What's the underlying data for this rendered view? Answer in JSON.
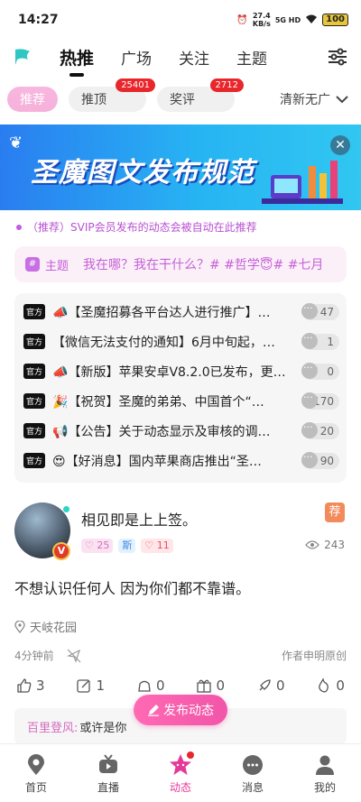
{
  "status_bar": {
    "time": "14:27",
    "net_speed_value": "27.4",
    "net_speed_unit": "KB/s",
    "signal": "5G HD",
    "battery": "100"
  },
  "top_nav": {
    "tabs": [
      "热推",
      "广场",
      "关注",
      "主题"
    ],
    "active_tab": "热推"
  },
  "sub_tabs": {
    "items": [
      {
        "label": "推荐",
        "badge": ""
      },
      {
        "label": "推顶",
        "badge": "25401"
      },
      {
        "label": "奖评",
        "badge": "2712"
      }
    ],
    "mode": "清新无广"
  },
  "banner": {
    "title": "圣魔图文发布规范",
    "close": "✕"
  },
  "promo": {
    "text": "（推荐）SVIP会员发布的动态会被自动在此推荐"
  },
  "topic": {
    "label": "主题",
    "text": "我在哪？我在干什么？# #哲学😇# #七月"
  },
  "notices": [
    {
      "tag": "官方",
      "text": "📣【圣魔招募各平台达人进行推广】…",
      "count": "47"
    },
    {
      "tag": "官方",
      "text": "【微信无法支付的通知】6月中旬起，…",
      "count": "1"
    },
    {
      "tag": "官方",
      "text": "📣【新版】苹果安卓V8.2.0已发布，更…",
      "count": "0"
    },
    {
      "tag": "官方",
      "text": "🎉【祝贺】圣魔的弟弟、中国首个“…",
      "count": "170"
    },
    {
      "tag": "官方",
      "text": "📢【公告】关于动态显示及审核的调…",
      "count": "20"
    },
    {
      "tag": "官方",
      "text": "😍【好消息】国内苹果商店推出“圣…",
      "count": "90"
    }
  ],
  "post": {
    "nickname": "相见即是上上签。",
    "tags": [
      "25",
      "斯",
      "11"
    ],
    "rec_badge": "荐",
    "views": "243",
    "body": "不想认识任何人 因为你们都不靠谱。",
    "location": "天岐花园",
    "time": "4分钟前",
    "original": "作者申明原创",
    "actions": {
      "like": "3",
      "edit": "1",
      "gift1": "0",
      "gift2": "0",
      "share": "0",
      "hot": "0"
    },
    "comment_user": "百里登风:",
    "comment_text": "或许是你"
  },
  "publish_button": "发布动态",
  "bottom_nav": [
    "首页",
    "直播",
    "动态",
    "消息",
    "我的"
  ],
  "colors": {
    "accent": "#e5399a",
    "promo": "#b84fd1",
    "badge_red": "#e8262b"
  }
}
